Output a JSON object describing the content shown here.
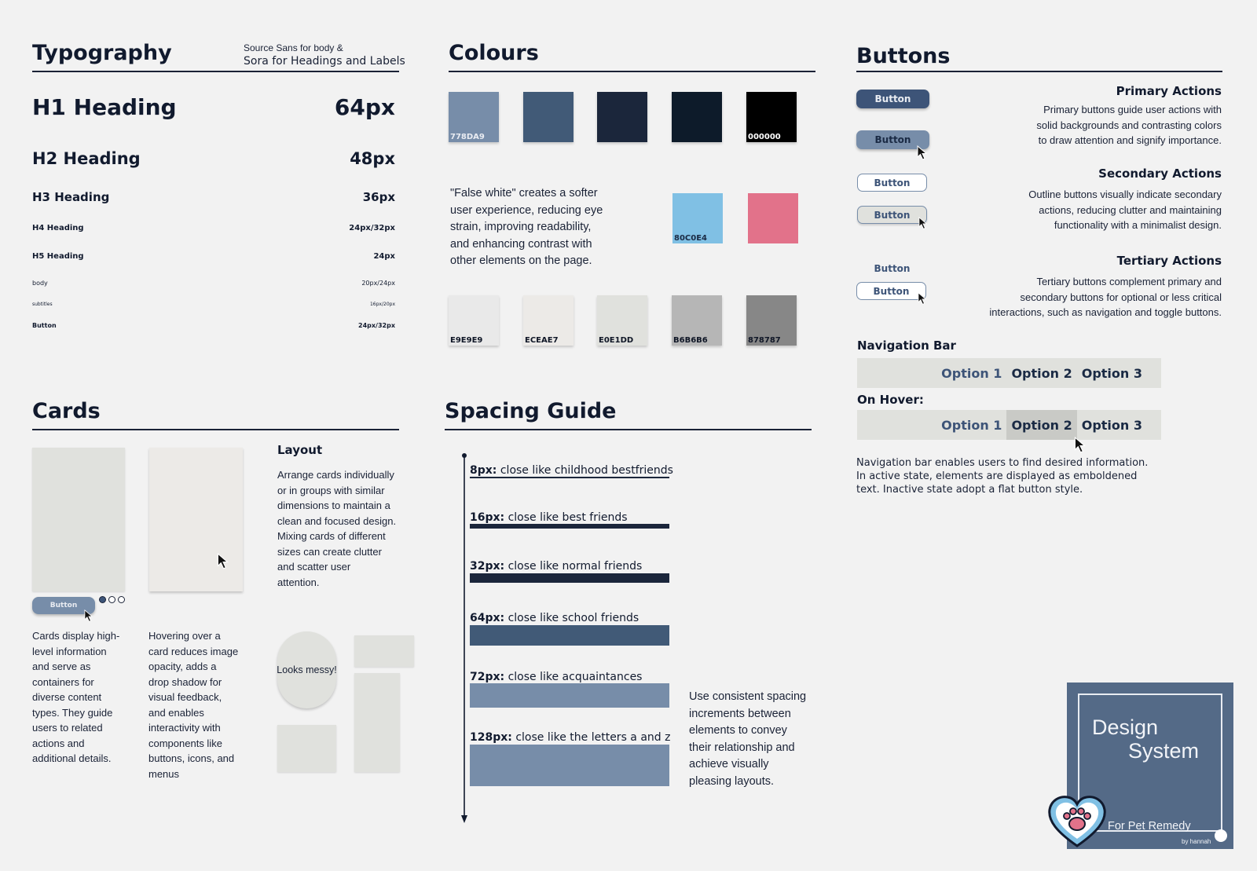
{
  "typography": {
    "title": "Typography",
    "note_line1": "Source Sans for body &",
    "note_line2": "Sora for Headings and Labels",
    "rows": [
      {
        "label": "H1 Heading",
        "size": "64px"
      },
      {
        "label": "H2 Heading",
        "size": "48px"
      },
      {
        "label": "H3 Heading",
        "size": "36px"
      },
      {
        "label": "H4 Heading",
        "size": "24px/32px"
      },
      {
        "label": "H5 Heading",
        "size": "24px"
      },
      {
        "label": "body",
        "size": "20px/24px"
      },
      {
        "label": "subtitles",
        "size": "16px/20px"
      },
      {
        "label": "Button",
        "size": "24px/32px"
      }
    ]
  },
  "colours": {
    "title": "Colours",
    "row1": [
      {
        "hex": "#778DA9",
        "label": "778DA9"
      },
      {
        "hex": "#415A77",
        "label": ""
      },
      {
        "hex": "#1B263B",
        "label": ""
      },
      {
        "hex": "#0D1B2A",
        "label": ""
      },
      {
        "hex": "#000000",
        "label": "000000"
      }
    ],
    "accents": [
      {
        "hex": "#80C0E4",
        "label": "80C0E4"
      },
      {
        "hex": "#E2728A",
        "label": ""
      }
    ],
    "neutrals": [
      {
        "hex": "#E9E9E9",
        "label": "E9E9E9"
      },
      {
        "hex": "#ECEAE7",
        "label": "ECEAE7"
      },
      {
        "hex": "#E0E1DD",
        "label": "E0E1DD"
      },
      {
        "hex": "#B6B6B6",
        "label": "B6B6B6"
      },
      {
        "hex": "#878787",
        "label": "878787"
      }
    ],
    "false_white_lines": [
      "\"False white\" creates a softer",
      "user experience, reducing eye",
      "strain, improving readability,",
      "and enhancing contrast with",
      "other elements on the page."
    ]
  },
  "buttons": {
    "title": "Buttons",
    "button_label": "Button",
    "primary": {
      "title": "Primary Actions",
      "lines": [
        "Primary buttons guide user actions with",
        "solid backgrounds and contrasting colors",
        "to draw attention and signify importance."
      ]
    },
    "secondary": {
      "title": "Secondary Actions",
      "lines": [
        "Outline buttons visually indicate secondary",
        "actions, reducing clutter and maintaining",
        "functionality with a minimalist design."
      ]
    },
    "tertiary": {
      "title": "Tertiary Actions",
      "lines": [
        "Tertiary buttons complement primary and",
        "secondary buttons for optional or less critical",
        "interactions, such as navigation and toggle buttons."
      ]
    }
  },
  "navigation": {
    "title": "Navigation Bar",
    "hover_title": "On Hover:",
    "options": [
      "Option 1",
      "Option 2",
      "Option 3"
    ],
    "desc_lines": [
      "Navigation bar enables users to find desired information.",
      "In active state, elements are displayed as emboldened",
      "text. Inactive state adopt a flat button style."
    ]
  },
  "cards": {
    "title": "Cards",
    "button_label": "Button",
    "layout_title": "Layout",
    "layout_lines": [
      "Arrange cards individually",
      "or in groups with similar",
      "dimensions to maintain a",
      "clean and focused design.",
      "Mixing cards of different",
      "sizes can create clutter",
      "and scatter user",
      "attention."
    ],
    "desc1_lines": [
      "Cards display high-",
      "level information",
      "and serve as",
      "containers for",
      "diverse content",
      "types. They guide",
      "users to related",
      "actions and",
      "additional details."
    ],
    "desc2_lines": [
      "Hovering over a",
      "card reduces image",
      "opacity, adds a",
      "drop shadow for",
      "visual feedback,",
      "and enables",
      "interactivity with",
      "components like",
      "buttons, icons, and",
      "menus"
    ],
    "messy_label": "Looks messy!"
  },
  "spacing": {
    "title": "Spacing Guide",
    "items": [
      {
        "size": "8px:",
        "text": " close like childhood bestfriends",
        "color": "#1B263B"
      },
      {
        "size": "16px:",
        "text": " close like best friends",
        "color": "#1B263B"
      },
      {
        "size": "32px:",
        "text": " close like normal friends",
        "color": "#1B263B"
      },
      {
        "size": "64px:",
        "text": " close like school friends",
        "color": "#415A77"
      },
      {
        "size": "72px:",
        "text": " close like acquaintances",
        "color": "#778DA9"
      },
      {
        "size": "128px:",
        "text": " close like the letters a and z",
        "color": "#778DA9"
      }
    ],
    "desc_lines": [
      "Use consistent spacing",
      "increments between",
      "elements to convey",
      "their relationship and",
      "achieve visually",
      "pleasing layouts."
    ]
  },
  "logo": {
    "line1": "Design",
    "line2": "System",
    "subtitle": "For Pet Remedy",
    "by": "by hannah"
  }
}
